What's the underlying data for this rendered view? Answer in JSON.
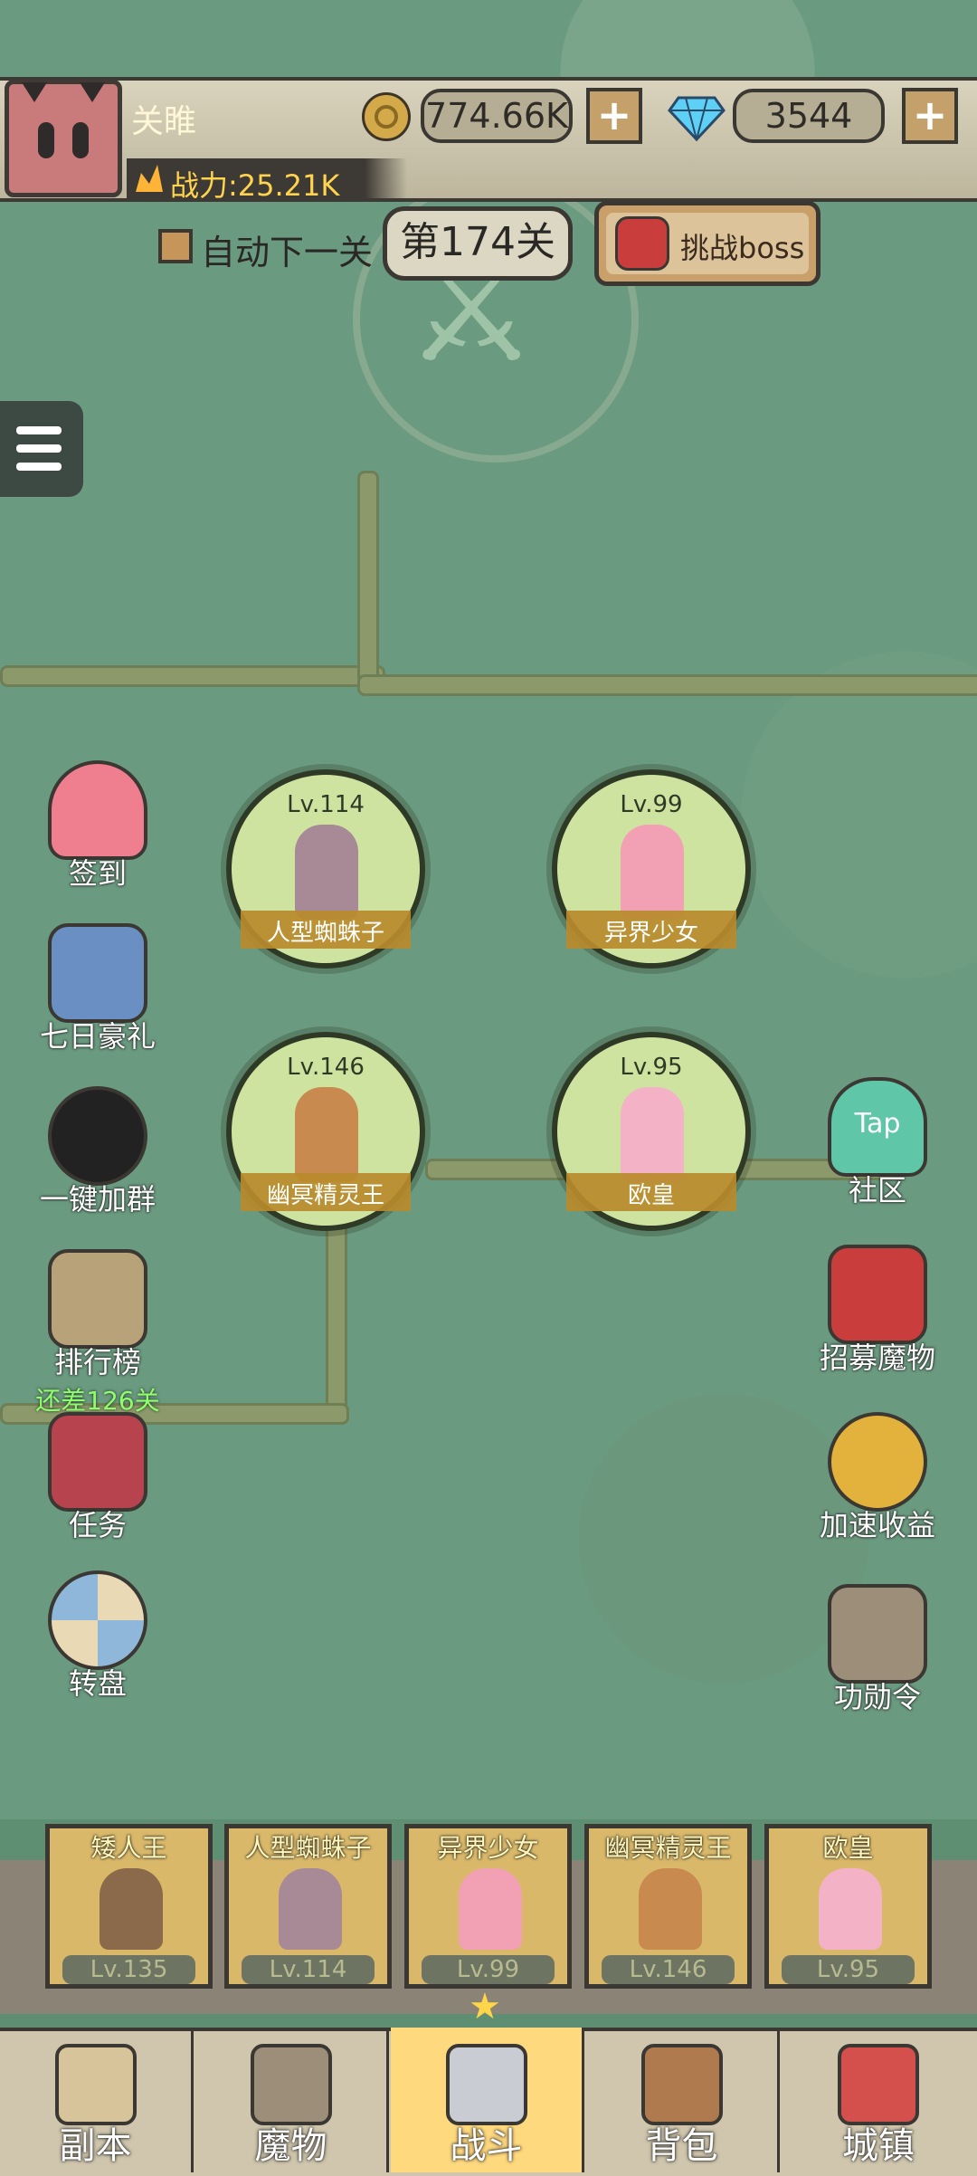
{
  "player": {
    "name": "关睢",
    "power": "战力:25.21K"
  },
  "currency": {
    "gold": "774.66K",
    "gems": "3544",
    "plus": "+"
  },
  "stage": {
    "auto_next": "自动下一关",
    "level": "第174关",
    "boss_button": "挑战boss"
  },
  "heroes": [
    {
      "lv": "Lv.114",
      "name": "人型蜘蛛子"
    },
    {
      "lv": "Lv.99",
      "name": "异界少女"
    },
    {
      "lv": "Lv.146",
      "name": "幽冥精灵王"
    },
    {
      "lv": "Lv.95",
      "name": "欧皇"
    }
  ],
  "left_menu": [
    {
      "label": "签到"
    },
    {
      "label": "七日豪礼"
    },
    {
      "label": "一键加群"
    },
    {
      "label": "排行榜",
      "sub": "还差126关"
    },
    {
      "label": "任务"
    },
    {
      "label": "转盘"
    }
  ],
  "right_menu": [
    {
      "label": "社区",
      "icon_text": "Tap"
    },
    {
      "label": "招募魔物"
    },
    {
      "label": "加速收益"
    },
    {
      "label": "功勋令"
    }
  ],
  "team": [
    {
      "name": "矮人王",
      "lv": "Lv.135"
    },
    {
      "name": "人型蜘蛛子",
      "lv": "Lv.114"
    },
    {
      "name": "异界少女",
      "lv": "Lv.99"
    },
    {
      "name": "幽冥精灵王",
      "lv": "Lv.146"
    },
    {
      "name": "欧皇",
      "lv": "Lv.95"
    }
  ],
  "nav": [
    {
      "label": "副本"
    },
    {
      "label": "魔物"
    },
    {
      "label": "战斗"
    },
    {
      "label": "背包"
    },
    {
      "label": "城镇"
    }
  ],
  "colors": {
    "accent": "#ffd97e",
    "power": "#ffd34e",
    "hint": "#8dff6b"
  }
}
